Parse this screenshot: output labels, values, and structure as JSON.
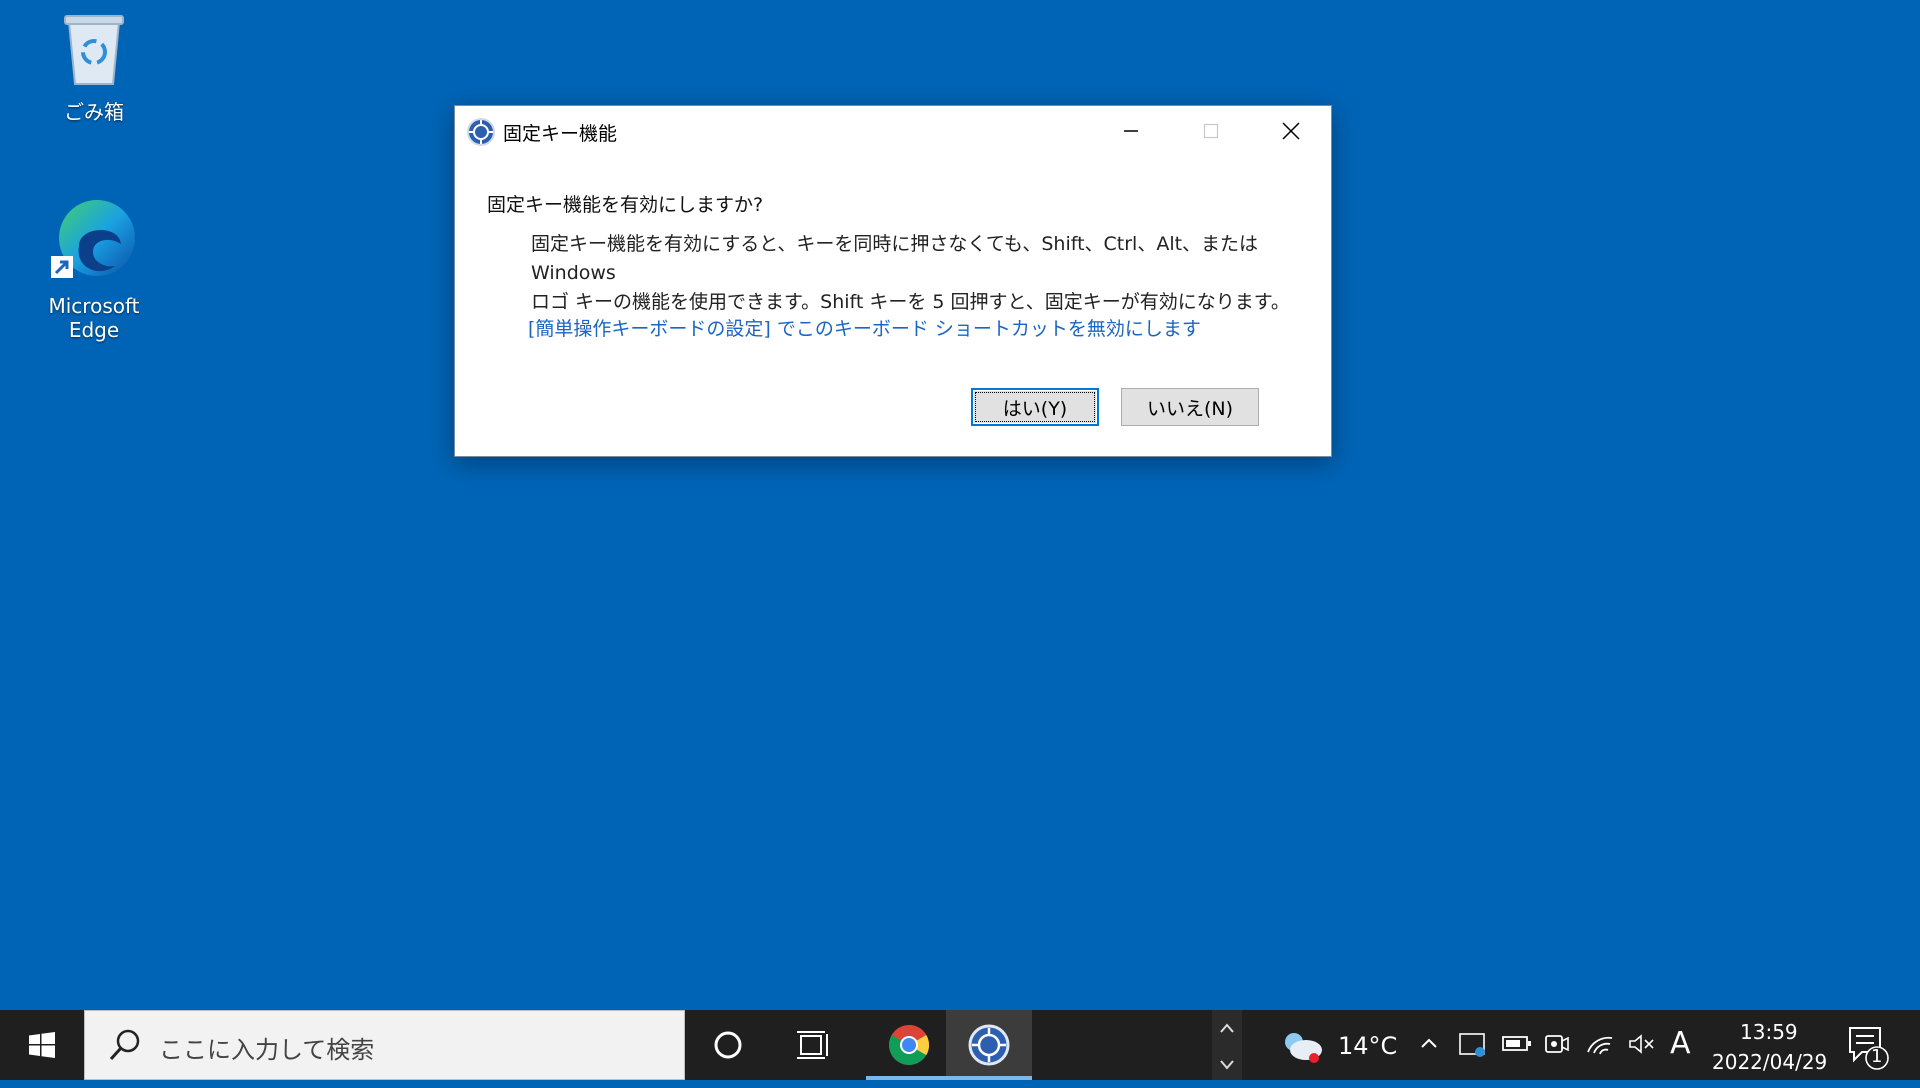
{
  "desktop": {
    "icons": [
      {
        "label": "ごみ箱"
      },
      {
        "label": "Microsoft Edge"
      }
    ]
  },
  "dialog": {
    "title": "固定キー機能",
    "question": "固定キー機能を有効にしますか?",
    "body_line1": "固定キー機能を有効にすると、キーを同時に押さなくても、Shift、Ctrl、Alt、または Windows",
    "body_line2": "ロゴ キーの機能を使用できます。Shift キーを 5 回押すと、固定キーが有効になります。",
    "link": "[簡単操作キーボードの設定] でこのキーボード ショートカットを無効にします",
    "yes_label": "はい(Y)",
    "no_label": "いいえ(N)"
  },
  "taskbar": {
    "search_placeholder": "ここに入力して検索",
    "weather": "14°C",
    "ime": "A",
    "time": "13:59",
    "date": "2022/04/29",
    "notification_count": "1"
  },
  "colors": {
    "desktop_bg": "#0064b6",
    "taskbar_bg": "#1f1f1f",
    "link": "#1a66c2",
    "accent": "#0078d7"
  }
}
